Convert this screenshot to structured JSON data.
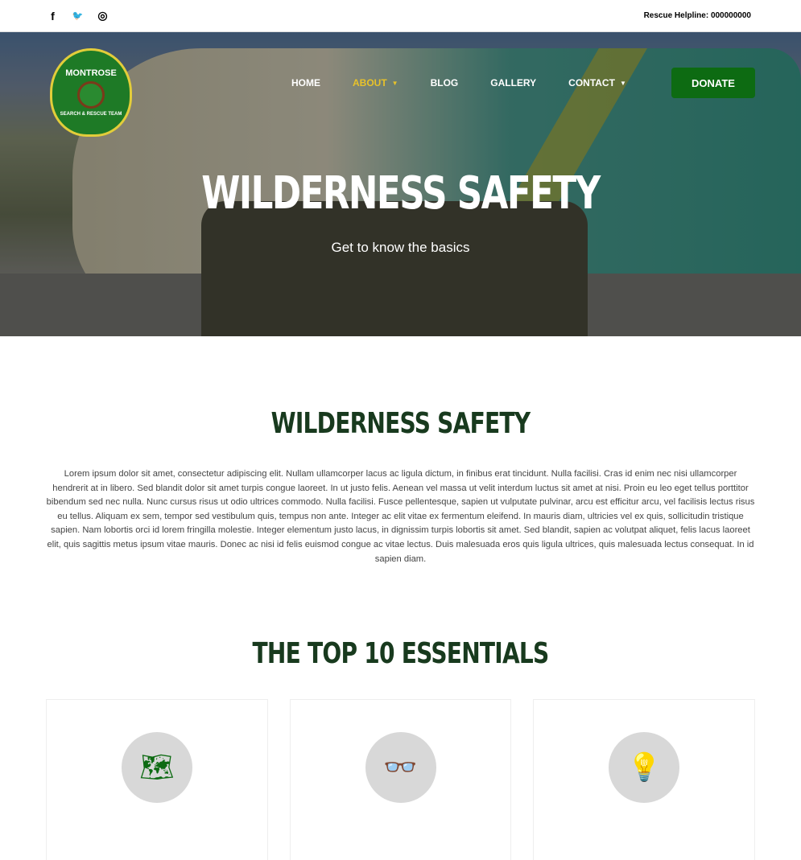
{
  "topbar": {
    "social": [
      {
        "icon": "facebook-icon",
        "glyph": "f"
      },
      {
        "icon": "twitter-icon",
        "glyph": "🐦"
      },
      {
        "icon": "instagram-icon",
        "glyph": "◎"
      }
    ],
    "helpline": "Rescue Helpline: 000000000"
  },
  "logo": {
    "text": "MONTROSE",
    "subtext": "SEARCH & RESCUE TEAM"
  },
  "nav": {
    "items": [
      {
        "label": "HOME"
      },
      {
        "label": "ABOUT",
        "dropdown": true,
        "active": true
      },
      {
        "label": "BLOG"
      },
      {
        "label": "GALLERY"
      },
      {
        "label": "CONTACT",
        "dropdown": true
      }
    ],
    "donate": "DONATE"
  },
  "hero": {
    "title": "WILDERNESS SAFETY",
    "subtitle": "Get to know the basics"
  },
  "intro": {
    "title": "WILDERNESS SAFETY",
    "body": "Lorem ipsum dolor sit amet, consectetur adipiscing elit. Nullam ullamcorper lacus ac ligula dictum, in finibus erat tincidunt. Nulla facilisi. Cras id enim nec nisi ullamcorper hendrerit at in libero. Sed blandit dolor sit amet turpis congue laoreet. In ut justo felis.  Aenean vel massa ut velit interdum luctus sit amet at nisi. Proin eu leo eget tellus porttitor bibendum sed nec nulla. Nunc cursus risus ut odio ultrices commodo. Nulla facilisi. Fusce pellentesque, sapien ut vulputate pulvinar, arcu est efficitur arcu, vel facilisis lectus risus eu tellus. Aliquam ex sem, tempor sed vestibulum quis, tempus non ante. Integer ac elit vitae ex fermentum eleifend. In mauris diam, ultricies vel ex quis, sollicitudin tristique sapien. Nam lobortis orci id lorem fringilla molestie. Integer elementum justo lacus, in dignissim turpis lobortis sit amet. Sed blandit, sapien ac volutpat aliquet, felis lacus laoreet elit, quis sagittis metus ipsum vitae mauris. Donec ac nisi id felis euismod congue ac vitae lectus. Duis malesuada eros quis ligula ultrices, quis malesuada lectus consequat. In id sapien diam."
  },
  "essentials": {
    "title": "THE TOP 10 ESSENTIALS",
    "cards": [
      {
        "icon": "map-icon",
        "glyph": "🗺"
      },
      {
        "icon": "glasses-icon",
        "glyph": "👓"
      },
      {
        "icon": "lightbulb-icon",
        "glyph": "💡"
      }
    ]
  },
  "colors": {
    "brand_green": "#0d6b12",
    "heading": "#183a1e",
    "nav_active": "#e8c22a"
  }
}
